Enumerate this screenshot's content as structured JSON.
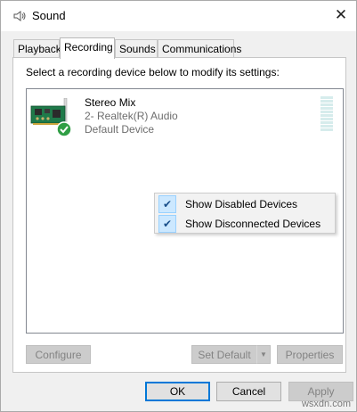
{
  "window": {
    "title": "Sound",
    "close_glyph": "✕"
  },
  "tabs": [
    {
      "label": "Playback",
      "active": false
    },
    {
      "label": "Recording",
      "active": true
    },
    {
      "label": "Sounds",
      "active": false
    },
    {
      "label": "Communications",
      "active": false
    }
  ],
  "panel": {
    "instructions": "Select a recording device below to modify its settings:"
  },
  "device": {
    "name": "Stereo Mix",
    "description": "2- Realtek(R) Audio",
    "status": "Default Device",
    "default_badge_color": "#2f9e44",
    "board_color": "#1f7a4a"
  },
  "context_menu": {
    "items": [
      {
        "label": "Show Disabled Devices",
        "checked": true
      },
      {
        "label": "Show Disconnected Devices",
        "checked": true
      }
    ],
    "check_glyph": "✔"
  },
  "buttons": {
    "configure": "Configure",
    "set_default": "Set Default",
    "properties": "Properties",
    "ok": "OK",
    "cancel": "Cancel",
    "apply": "Apply",
    "dropdown_glyph": "▼"
  },
  "watermark": "wsxdn.com",
  "colors": {
    "accent": "#0078d7",
    "menu_highlight": "#cce8ff",
    "level_bar": "#d6ecec"
  }
}
